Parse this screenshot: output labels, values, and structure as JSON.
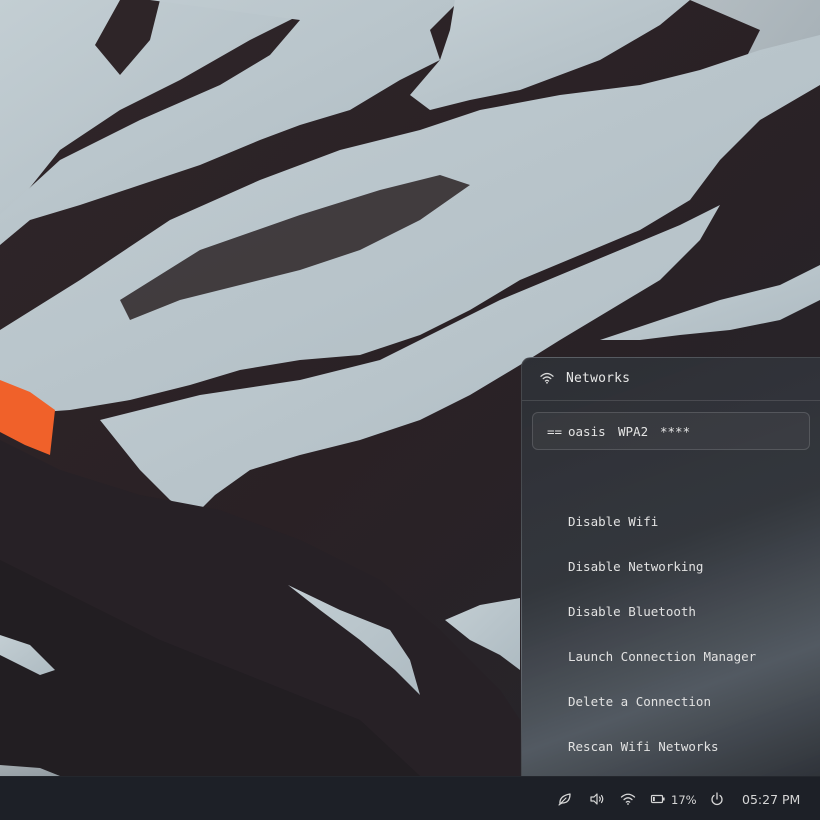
{
  "network_panel": {
    "title": "Networks",
    "connected_network": {
      "prefix": "==",
      "ssid": "oasis",
      "security": "WPA2",
      "signal": "****"
    },
    "actions": [
      "Disable Wifi",
      "Disable Networking",
      "Disable Bluetooth",
      "Launch Connection Manager",
      "Delete a Connection",
      "Rescan Wifi Networks"
    ]
  },
  "taskbar": {
    "battery": "17%",
    "clock": "05:27 PM",
    "tray_icons": [
      "leaf-icon",
      "volume-icon",
      "wifi-icon",
      "battery-icon",
      "power-icon"
    ]
  },
  "colors": {
    "snow": "#b9c5cb",
    "rock": "#2a2226",
    "accent_orange": "#f0612a",
    "panel_text": "#e2e2e2",
    "taskbar_bg": "#1d2027"
  }
}
